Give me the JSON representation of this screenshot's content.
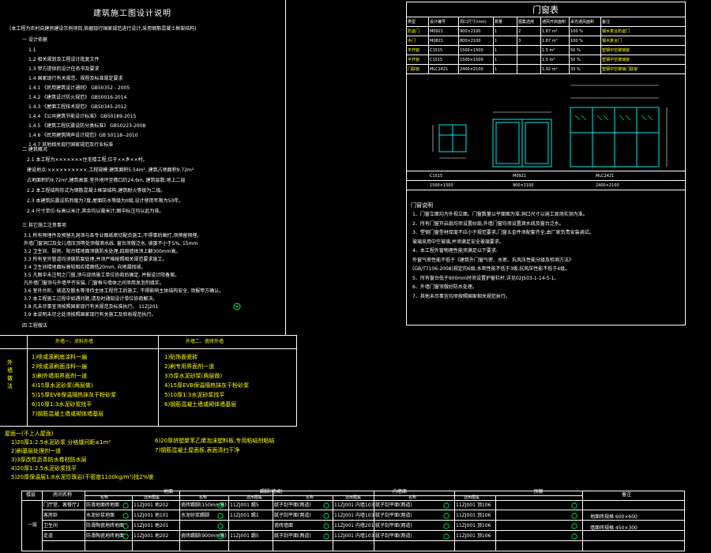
{
  "notes": {
    "title": "建筑施工图设计说明",
    "line_project": "(本工程为农村自建房建设示例项目,依据现行国家规范进行设计,采用钢筋混凝土框架结构)",
    "section1": "一  设计依据",
    "items": [
      "1.1",
      "1.2   相关规划及工程设计批复文件",
      "1.3   甲方提供的设计任务书及要求",
      "1.4   国家现行有关规范、规程及标准规定要求",
      "1.4.1   《民用建筑设计通则》   GB50352  -  2005",
      "1.4.2   《建筑设计防火规范》   GB50016-2014",
      "1.4.3   《屋面工程技术规范》   GB50345-2012",
      "1.4.4   《公共建筑节能设计标准》   GB50189-2015",
      "1.4.5   《建筑工程抗震设防分类标准》   GB50223-2008",
      "1.4.6   《民用建筑隔声设计规范》GB 50118--2010",
      "1.4.7   其他相关现行国家规范及行业标准"
    ],
    "section2": "二  建筑概况",
    "overview": [
      "2.1  本工程为×××××××住宅楼工程,位于××乡××村。",
      "     建设地点:××××××××××,工程规模:建筑面积5.54m²,  建筑占地面积9.72m²",
      "     占地面积约9.72m²,建筑高度:室外地坪至檐口约24.6m,  建筑层数:地上二层",
      "2.2 本工程结构形式为钢筋混凝土框架结构,建筑耐火等级为二级。",
      "2.3 本建筑抗震设防烈度为7度,屋面防水等级为II级,设计使用年限为50年。",
      "2.4 尺寸单位:标高以米计,其余均以毫米计;图中标注均以此为准。"
    ],
    "section3": "三  其它施工注意事项",
    "others": [
      "3.1   所有预埋件及预留孔洞须与各专业图纸密切配合施工,不得事后凿打,须预留预埋。",
      "      外墙门窗洞口及女儿墙压顶等处须做滴水线,  窗台须做泛水,  坡度不小于5%,  15mm",
      "3.2   卫生间、厨房、阳台楼地面须做防水处理,四周墙体须上翻300mm高。",
      "3.3   所有室外管道均须做防腐处理,并须严格按照相关规范要求施工。",
      "3.4   卫生间楼地面标高较相应楼面低20mm,  向地漏找坡。",
      "3.5   凡图中未注明之门窗,须与现场施工单位协商后确定,  并报设计院备案。",
      "      凡外墙门窗须与外墙平齐安装,  门窗框与墙体之间须用发泡剂填实。",
      "3.6   室外台阶、坡道及散水等须待主体工程完工后施工,  不得影响主体结构安全,  须报甲方确认。",
      "3.7   本工程施工过程中如遇问题,请及时通知设计单位协商解决。",
      "3.8   凡未尽事宜须按照国家现行有关规范及标准执行。  11ZJ201",
      "3.9   本说明未尽之处须按照国家现行有关施工及验收规范执行。"
    ],
    "section4": "四  工程做法"
  },
  "wall_table": {
    "left_header": "外墙一、涂料外墙",
    "right_header": "外墙二、瓷砖外墙",
    "side_label": "外 墙 做 法",
    "left_items": [
      "1)喷或滚刷底涂料一遍",
      "2)喷或滚刷面涂料一遍",
      "3)刷外墙用界面剂一道",
      "4)15厚水泥砂浆(两层做)",
      "5)15厚EVB保温隔热抹灰干粉砂浆",
      "6)10厚1:3水泥砂浆找平",
      "7)钢筋混凝土墙或砌体墙基层"
    ],
    "right_items": [
      "1)贴饰面瓷砖",
      "2)刷专用界面剂一道",
      "3)5厚水泥砂浆(两层做)",
      "4)15厚EVB保温隔热抹灰干粉砂浆",
      "5)10厚1:3水泥砂浆找平",
      "6)钢筋混凝土墙或砌体墙基层"
    ]
  },
  "roof": {
    "title": "屋面一(不上人屋面)",
    "items_left": [
      "1)20厚1:2.5水泥砂浆  分格缝间距≤1m²",
      "2)刷基层处理剂一道",
      "3)3厚改性沥青防水卷材防水层",
      "4)20厚1:2.5水泥砂浆找平",
      "5)20厚保温层1:8水泥珍珠岩(干密度1100kg/m³)找2%坡"
    ],
    "items_right": [
      "6)20厚挤塑聚苯乙烯泡沫塑料板,专用粘结剂粘结",
      "7)钢筋混凝土屋面板,表面清扫干净"
    ]
  },
  "door_table": {
    "title": "门窗表",
    "headers": [
      "类型",
      "设计编号",
      "洞口尺寸(mm)",
      "数量",
      "图集选用",
      "通风开启面积",
      "采光通风面积",
      "备注"
    ],
    "rows": [
      [
        "防盗门",
        "M0921",
        "900×2100",
        "1",
        "2",
        "1.87 m²",
        "100 %",
        "钢木复合防盗门"
      ],
      [
        "木门",
        "M0821",
        "800×2100",
        "1",
        "3",
        "1.87 m²",
        "100 %",
        "钢木复合门"
      ],
      [
        "平开窗",
        "C1515",
        "1500×1500",
        "1",
        "",
        "1.5 m²",
        "50 %",
        "塑钢中空玻璃窗"
      ],
      [
        "平开窗",
        "C1515",
        "1500×1500",
        "1",
        "",
        "1.5 m²",
        "50 %",
        "塑钢中空玻璃窗"
      ],
      [
        "门联窗",
        "MLC2421",
        "2400×2100",
        "1",
        "",
        "1.92 m²",
        "33 %",
        "塑钢中空玻璃门联窗"
      ]
    ],
    "elev_labels": [
      "C1515",
      "M0921",
      "MLC2421"
    ],
    "elev_sub": [
      "1500×1500",
      "900×2100",
      "2400×2100"
    ],
    "notes_title": "门窗说明",
    "notes": [
      "1、门窗立面均为外视立面。门窗数量以平面图为准,洞口尺寸以施工现场实测为准。",
      "2、所有门窗开启扇均须设置纱扇,外墙门窗均须设置滴水线及窗台泛水。",
      "3、塑钢门窗型材厚度不应小于规范要求,门窗五金件须配套齐全,由厂家负责安装调试。",
      "   玻璃采用中空玻璃,并须满足安全玻璃要求。",
      "4、本工程外窗物理性能须满足以下要求:",
      "   外窗气密性能不低于《建筑外门窗气密、水密、抗风压性能分级及检测方法》",
      "   (GB/T7106-2008)规定的6级,水密性能不低于3级,抗风压性能不低于4级。",
      "5、所有窗台低于900mm时须设置护窗栏杆,详见02J503-1-14-5-1。",
      "6、外墙门窗须做好防水处理。",
      "7、其他未尽事宜均须按照国家相关规范执行。"
    ]
  },
  "finish_table": {
    "headers": [
      "楼层",
      "房间名称",
      "地面",
      "踢脚(墙裙)",
      "内墙面",
      "顶棚",
      "备注"
    ],
    "sub_headers": [
      "名称",
      "选用图集",
      "名称",
      "选用图集",
      "名称",
      "选用图集",
      "名称",
      "选用图集"
    ],
    "floor_label": "一层",
    "rows": [
      [
        "门厅堂、客餐厅2",
        "防滑地面砖地面",
        "11ZJ001  地202",
        "瓷砖踢脚(150mm高)",
        "11ZJ001  踢5",
        "腻子刮平面(两道)",
        "11ZJ001  内墙103",
        "腻子刮平面(两道)",
        "11ZJ001  顶106"
      ],
      [
        "客房卧",
        "水泥砂浆地面",
        "11ZJ001  地101",
        "水泥砂浆踢脚",
        "11ZJ001  踢1",
        "腻子刮平面(两道)",
        "11ZJ001  内墙103",
        "腻子刮平面(两道)",
        "11ZJ001  顶106"
      ],
      [
        "卫生间",
        "防滑陶瓷地砖地面",
        "11ZJ001  地201",
        "",
        "",
        "瓷砖墙面",
        "11ZJ001  内墙201",
        "腻子刮平面(两道)",
        "11ZJ001  顶106"
      ],
      [
        "走道",
        "防滑陶瓷地砖地面",
        "11ZJ001  地202",
        "瓷砖踢脚(900mm高)",
        "11ZJ001  踢5",
        "腻子刮平面(两道)",
        "11ZJ001  内墙103",
        "腻子刮平面(两道)",
        "11ZJ001  顶106"
      ]
    ],
    "remarks": [
      "地面砖规格 600×600",
      "墙面砖规格 450×300"
    ]
  }
}
